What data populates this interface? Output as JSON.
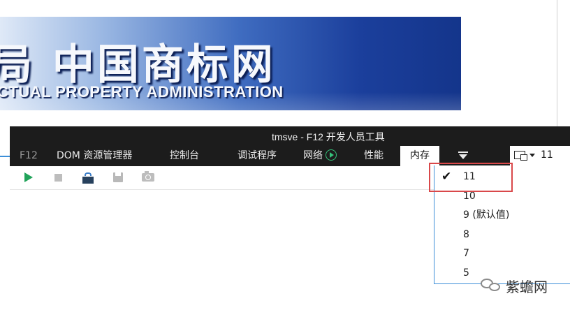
{
  "banner": {
    "title_cn": "局 中国商标网",
    "title_en": "CTUAL PROPERTY ADMINISTRATION"
  },
  "window": {
    "title": "tmsve - F12 开发人员工具"
  },
  "tabs": [
    {
      "label": "F12"
    },
    {
      "label": "DOM 资源管理器"
    },
    {
      "label": "控制台"
    },
    {
      "label": "调试程序"
    },
    {
      "label": "网络"
    },
    {
      "label": "性能"
    },
    {
      "label": "内存"
    }
  ],
  "emulation": {
    "current_mode": "11"
  },
  "toolbar": {
    "icons": [
      "play-icon",
      "stop-icon",
      "import-icon",
      "save-icon",
      "camera-icon"
    ]
  },
  "document_mode_menu": {
    "selected": "11",
    "items": [
      "11",
      "10",
      "9 (默认值)",
      "8",
      "7",
      "5"
    ]
  },
  "watermark": {
    "text": "紫蟾网"
  },
  "colors": {
    "devtools_bg": "#1c1c1c",
    "accent_blue": "#3d8fd8",
    "highlight_red": "#d9484a",
    "play_green": "#21a35a"
  }
}
